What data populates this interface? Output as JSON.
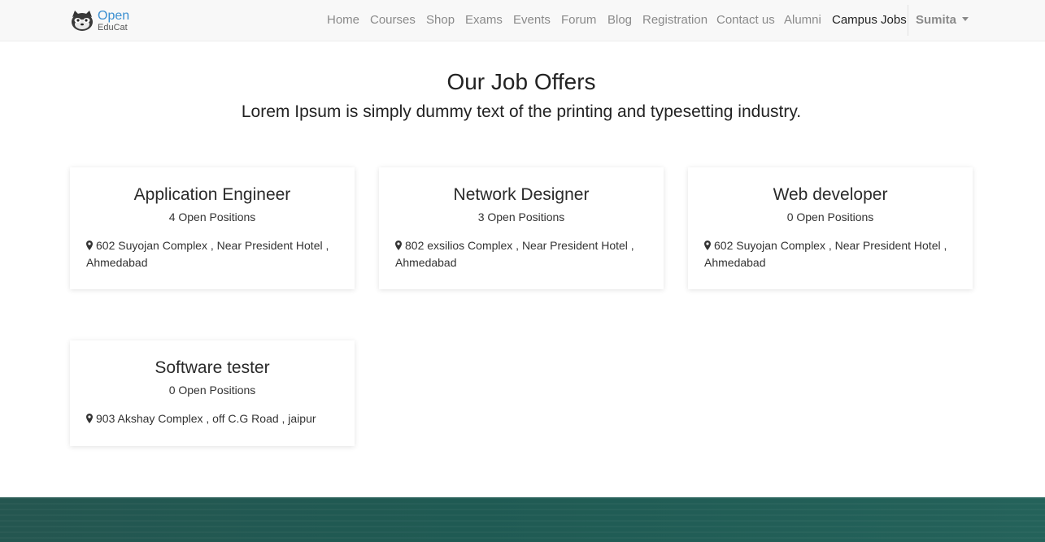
{
  "brand": {
    "line1": "Open",
    "line2": "EduCat"
  },
  "nav": {
    "items": [
      {
        "label": "Home"
      },
      {
        "label": "Courses"
      },
      {
        "label": "Shop"
      },
      {
        "label": "Exams"
      },
      {
        "label": "Events"
      },
      {
        "label": "Forum"
      },
      {
        "label": "Blog"
      },
      {
        "label": "Registration"
      },
      {
        "label": "Contact us"
      },
      {
        "label": "Alumni"
      },
      {
        "label": "Campus Jobs",
        "active": true
      }
    ],
    "user": "Sumita"
  },
  "header": {
    "title": "Our Job Offers",
    "subtitle": "Lorem Ipsum is simply dummy text of the printing and typesetting industry."
  },
  "jobs": [
    {
      "title": "Application Engineer",
      "positions": "4 Open Positions",
      "address": "602 Suyojan Complex , Near President Hotel , Ahmedabad"
    },
    {
      "title": "Network Designer",
      "positions": "3 Open Positions",
      "address": "802 exsilios Complex , Near President Hotel , Ahmedabad"
    },
    {
      "title": "Web developer",
      "positions": "0 Open Positions",
      "address": "602 Suyojan Complex , Near President Hotel , Ahmedabad"
    },
    {
      "title": "Software tester",
      "positions": "0 Open Positions",
      "address": "903 Akshay Complex , off C.G Road , jaipur"
    }
  ],
  "colors": {
    "brand_blue": "#3b8fd1",
    "nav_bg": "#f8f8f8",
    "footer": "#245650"
  },
  "icons": {
    "location": "map-marker-icon",
    "user_menu": "caret-down-icon"
  }
}
